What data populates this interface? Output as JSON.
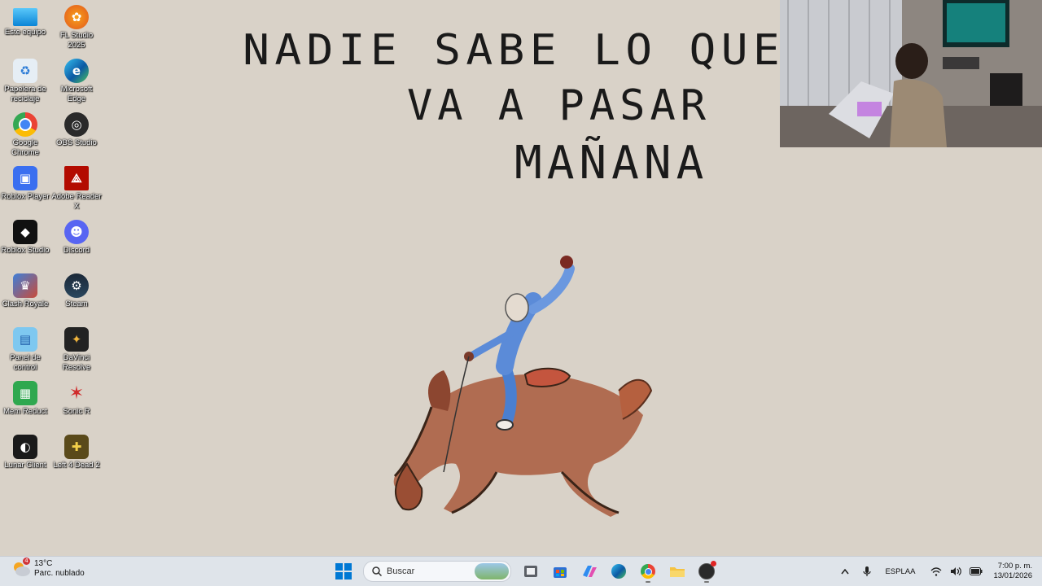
{
  "desktop": {
    "icons": [
      {
        "label": "Este equipo",
        "icon": "monitor-icon"
      },
      {
        "label": "FL Studio 2025",
        "icon": "fl-studio-icon"
      },
      {
        "label": "Papelera de reciclaje",
        "icon": "recycle-bin-icon"
      },
      {
        "label": "Microsoft Edge",
        "icon": "edge-icon"
      },
      {
        "label": "Google Chrome",
        "icon": "chrome-icon"
      },
      {
        "label": "OBS Studio",
        "icon": "obs-icon"
      },
      {
        "label": "Roblox Player",
        "icon": "roblox-player-icon"
      },
      {
        "label": "Adobe Reader X",
        "icon": "adobe-reader-icon"
      },
      {
        "label": "Roblox Studio",
        "icon": "roblox-studio-icon"
      },
      {
        "label": "Discord",
        "icon": "discord-icon"
      },
      {
        "label": "Clash Royale",
        "icon": "clash-royale-icon"
      },
      {
        "label": "Steam",
        "icon": "steam-icon"
      },
      {
        "label": "Panel de control",
        "icon": "control-panel-icon"
      },
      {
        "label": "DaVinci Resolve",
        "icon": "davinci-resolve-icon"
      },
      {
        "label": "Mem Reduct",
        "icon": "mem-reduct-icon"
      },
      {
        "label": "Sonic R",
        "icon": "sonic-r-icon"
      },
      {
        "label": "Lunar Client",
        "icon": "lunar-client-icon"
      },
      {
        "label": "Left 4 Dead 2",
        "icon": "left-4-dead-2-icon"
      }
    ]
  },
  "wallpaper": {
    "line1": "NADIE SABE LO QUE",
    "line2": "VA A PASAR",
    "line3": "MAÑANA"
  },
  "taskbar": {
    "weather": {
      "temp": "13°C",
      "condition": "Parc. nublado",
      "badge": "4"
    },
    "search_placeholder": "Buscar",
    "tray": {
      "lang1": "ESP",
      "lang2": "LAA",
      "time": "7:00 p. m.",
      "date": "13/01/2026"
    }
  },
  "colors": {
    "background": "#d9d2c8",
    "taskbar": "#dfe4ea",
    "accent": "#0078d4"
  }
}
